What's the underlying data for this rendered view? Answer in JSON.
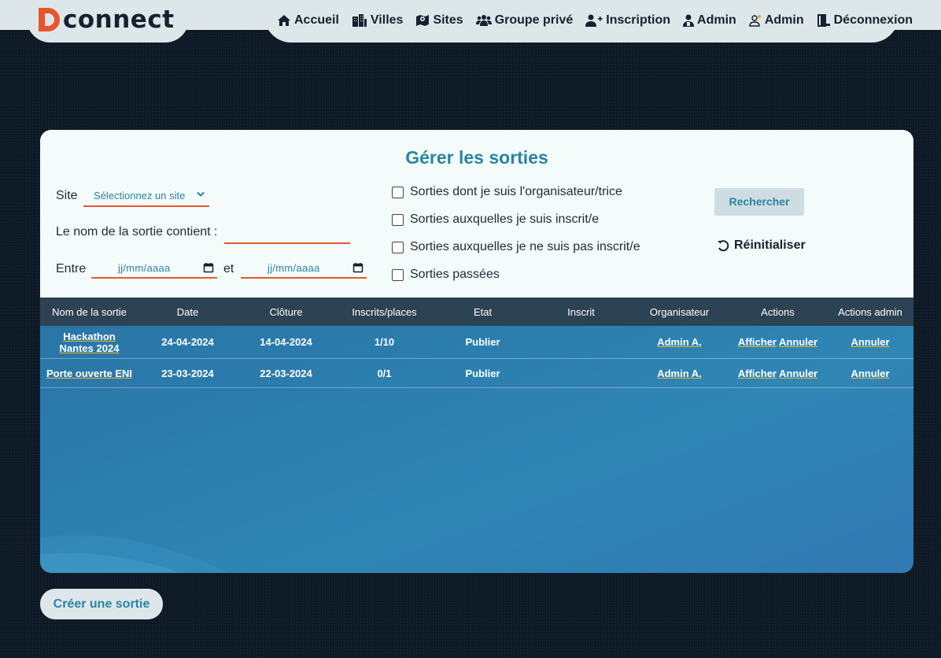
{
  "header": {
    "logo_text": "connect",
    "nav": [
      {
        "label": "Accueil",
        "icon": "home-icon"
      },
      {
        "label": "Villes",
        "icon": "city-icon"
      },
      {
        "label": "Sites",
        "icon": "map-icon"
      },
      {
        "label": "Groupe privé",
        "icon": "group-icon"
      },
      {
        "label": "Inscription",
        "icon": "user-plus-icon"
      },
      {
        "label": "Admin",
        "icon": "user-shield-icon"
      },
      {
        "label": "Admin",
        "icon": "user-gear-icon"
      },
      {
        "label": "Déconnexion",
        "icon": "door-icon"
      }
    ]
  },
  "filters": {
    "title": "Gérer les sorties",
    "site_label": "Site",
    "site_selected": "Sélectionnez un site",
    "name_label": "Le nom de la sortie contient :",
    "name_value": "",
    "between_label": "Entre",
    "and_label": "et",
    "date_start_placeholder": "jj/mm/aaaa",
    "date_end_placeholder": "jj/mm/aaaa",
    "checks": [
      "Sorties dont je suis l'organisateur/trice",
      "Sorties auxquelles je suis inscrit/e",
      "Sorties auxquelles je ne suis pas inscrit/e",
      "Sorties passées"
    ],
    "search_label": "Rechercher",
    "reset_label": "Réinitialiser"
  },
  "table": {
    "columns": [
      "Nom de la sortie",
      "Date",
      "Clôture",
      "Inscrits/places",
      "Etat",
      "Inscrit",
      "Organisateur",
      "Actions",
      "Actions admin"
    ],
    "rows": [
      {
        "name": "Hackathon Nantes 2024",
        "date": "24-04-2024",
        "cloture": "14-04-2024",
        "inscrits": "1/10",
        "etat": "Publier",
        "inscrit": "",
        "organisateur": "Admin A.",
        "action_show": "Afficher",
        "action_cancel": "Annuler",
        "admin_cancel": "Annuler"
      },
      {
        "name": "Porte ouverte ENI",
        "date": "23-03-2024",
        "cloture": "22-03-2024",
        "inscrits": "0/1",
        "etat": "Publier",
        "inscrit": "",
        "organisateur": "Admin A.",
        "action_show": "Afficher",
        "action_cancel": "Annuler",
        "admin_cancel": "Annuler"
      }
    ]
  },
  "create_button": "Créer une sortie",
  "colors": {
    "accent": "#2a84a2",
    "underline": "#e25a2c",
    "table_header": "#2d4252",
    "link_underline": "#f0b429"
  }
}
